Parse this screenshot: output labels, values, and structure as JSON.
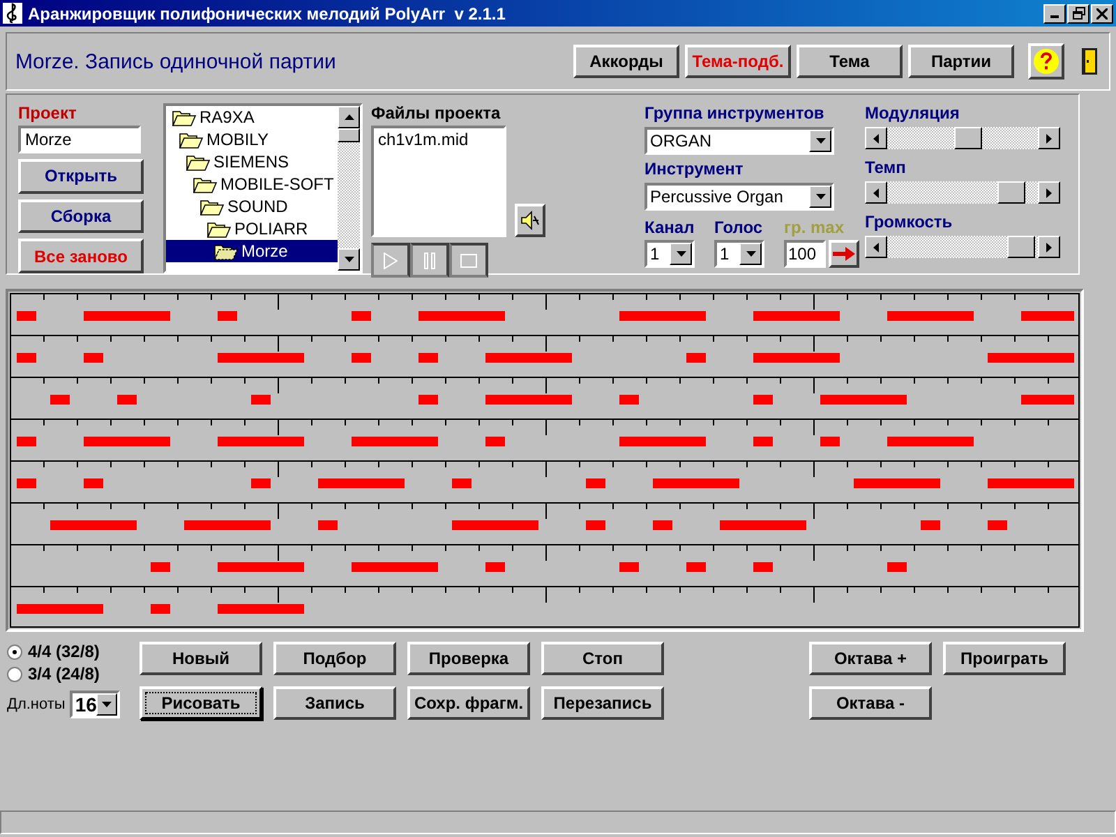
{
  "window": {
    "title": "Аранжировщик полифонических мелодий PolyArr  v 2.1.1"
  },
  "header": {
    "title": "Morze. Запись одиночной партии",
    "buttons": [
      {
        "label": "Аккорды",
        "kind": "plain"
      },
      {
        "label": "Тема-подб.",
        "kind": "alert"
      },
      {
        "label": "Тема",
        "kind": "plain"
      },
      {
        "label": "Партии",
        "kind": "plain"
      }
    ]
  },
  "project": {
    "label": "Проект",
    "value": "Morze",
    "buttons": [
      {
        "label": "Открыть",
        "kind": "plain"
      },
      {
        "label": "Сборка",
        "kind": "plain"
      },
      {
        "label": "Все заново",
        "kind": "alert"
      }
    ]
  },
  "folders": [
    {
      "name": "RA9XA",
      "selected": false,
      "children": [
        {
          "name": "MOBILY",
          "selected": false,
          "children": [
            {
              "name": "SIEMENS",
              "selected": false,
              "children": [
                {
                  "name": "MOBILE-SOFT",
                  "selected": false,
                  "children": [
                    {
                      "name": "SOUND",
                      "selected": false,
                      "children": [
                        {
                          "name": "POLIARR",
                          "selected": false,
                          "children": [
                            {
                              "name": "Morze",
                              "selected": true
                            }
                          ]
                        }
                      ]
                    }
                  ]
                }
              ]
            }
          ]
        }
      ]
    }
  ],
  "files": {
    "label": "Файлы проекта",
    "items": [
      "ch1v1m.mid"
    ]
  },
  "instruments": {
    "group_label": "Группа инструментов",
    "group": "ORGAN",
    "instrument_label": "Инструмент",
    "instrument": "Percussive Organ",
    "channel_label": "Канал",
    "channel": "1",
    "voice_label": "Голос",
    "voice": "1",
    "max_label": "гр. max",
    "max": "100"
  },
  "sliders": [
    {
      "label": "Модуляция",
      "level": 0.55
    },
    {
      "label": "Темп",
      "level": 0.9
    },
    {
      "label": "Громкость",
      "level": 0.98
    }
  ],
  "meter": [
    {
      "label": "4/4 (32/8)",
      "selected": true
    },
    {
      "label": "3/4 (24/8)",
      "selected": false
    }
  ],
  "note_length": {
    "label": "Дл.ноты",
    "value": "16"
  },
  "buttons": [
    {
      "label": "Новый",
      "focused": false
    },
    {
      "label": "Подбор",
      "focused": false
    },
    {
      "label": "Проверка",
      "focused": false
    },
    {
      "label": "Стоп",
      "focused": false
    },
    {
      "label": "Рисовать",
      "focused": true
    },
    {
      "label": "Запись",
      "focused": false
    },
    {
      "label": "Сохр. фрагм.",
      "focused": false
    },
    {
      "label": "Перезапись",
      "focused": false
    }
  ],
  "octave_buttons": [
    {
      "label": "Октава +"
    },
    {
      "label": "Проиграть"
    },
    {
      "label": "Октава -"
    }
  ]
}
